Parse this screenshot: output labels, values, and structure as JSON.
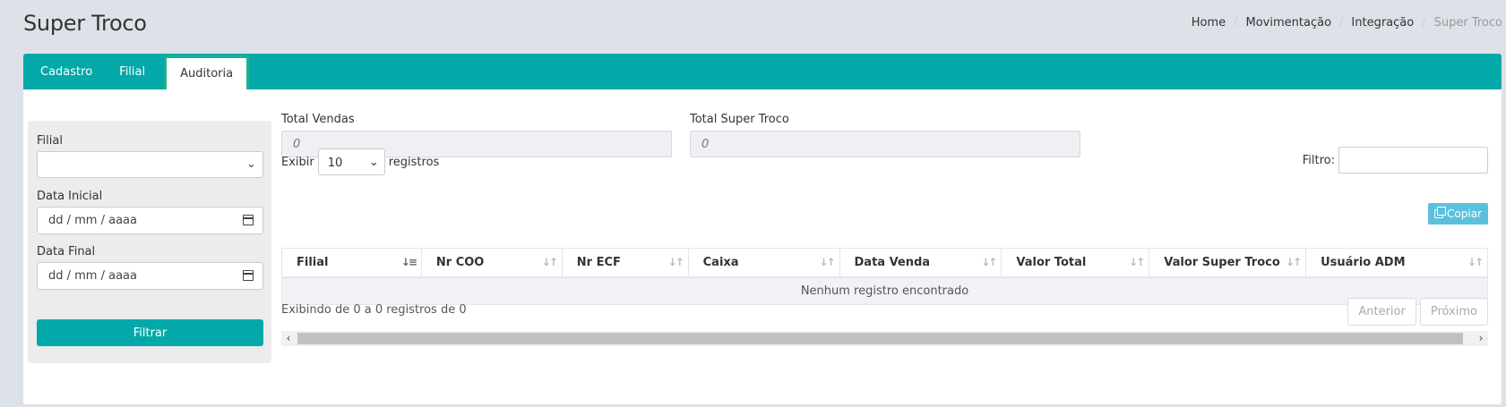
{
  "header": {
    "title": "Super Troco"
  },
  "breadcrumb": [
    "Home",
    "Movimentação",
    "Integração",
    "Super Troco"
  ],
  "tabs": [
    "Cadastro",
    "Filial",
    "Auditoria"
  ],
  "filters": {
    "filial_label": "Filial",
    "filial_value": "",
    "data_inicial_label": "Data Inicial",
    "data_inicial_placeholder": "dd / mm / aaaa",
    "data_final_label": "Data Final",
    "data_final_placeholder": "dd / mm / aaaa",
    "submit_label": "Filtrar"
  },
  "totals": {
    "vendas_label": "Total Vendas",
    "vendas_value": "0",
    "super_troco_label": "Total Super Troco",
    "super_troco_value": "0"
  },
  "table_controls": {
    "show_label": "Exibir",
    "page_length": "10",
    "records_label": "registros",
    "filter_label": "Filtro:",
    "copy_label": "Copiar"
  },
  "table": {
    "columns": [
      "Filial",
      "Nr COO",
      "Nr ECF",
      "Caixa",
      "Data Venda",
      "Valor Total",
      "Valor Super Troco",
      "Usuário ADM"
    ],
    "empty_message": "Nenhum registro encontrado"
  },
  "footer": {
    "info": "Exibindo de 0 a 0 registros de 0",
    "prev_label": "Anterior",
    "next_label": "Próximo"
  },
  "colors": {
    "accent": "#03a9a9",
    "copy_button": "#5bc0de"
  }
}
